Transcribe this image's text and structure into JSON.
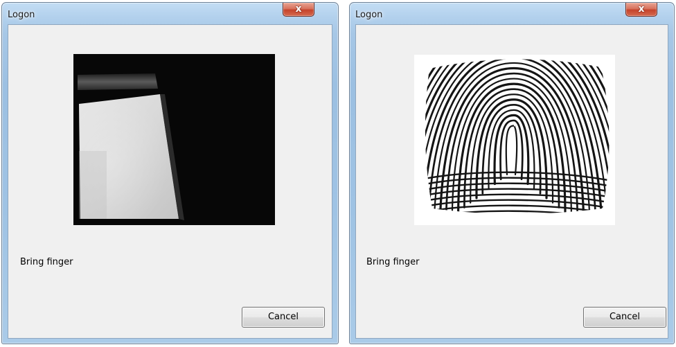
{
  "windows": [
    {
      "title": "Logon",
      "close_label": "x",
      "image": "sensor-camera-preview",
      "status_text": "Bring finger",
      "cancel_label": "Cancel"
    },
    {
      "title": "Logon",
      "close_label": "x",
      "image": "fingerprint-scan",
      "status_text": "Bring finger",
      "cancel_label": "Cancel"
    }
  ],
  "colors": {
    "client_bg": "#f0f0f0",
    "close_button": "#c5432b",
    "frame_glass": "#a6c7e6"
  }
}
